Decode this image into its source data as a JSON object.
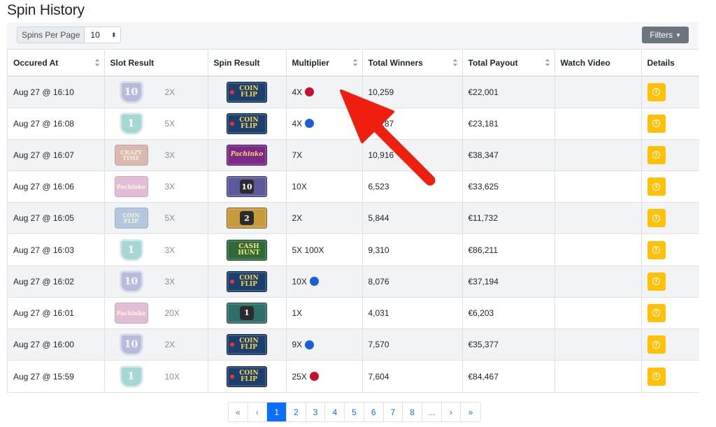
{
  "title": "Spin History",
  "toolbar": {
    "per_page_label": "Spins Per Page",
    "per_page_value": "10",
    "filters_label": "Filters"
  },
  "columns": [
    "Occured At",
    "Slot Result",
    "Spin Result",
    "Multiplier",
    "Total Winners",
    "Total Payout",
    "Watch Video",
    "Details"
  ],
  "rows": [
    {
      "occured_at": "Aug 27 @ 16:10",
      "slot_tile": "10",
      "slot_tile_color": "#8a8fc9",
      "slot_multiplier": "2X",
      "spin_result": "COIN FLIP",
      "multiplier": "4X",
      "multiplier_dot": "red",
      "total_winners": "10,259",
      "total_payout": "€22,001"
    },
    {
      "occured_at": "Aug 27 @ 16:08",
      "slot_tile": "1",
      "slot_tile_color": "#5fb7b0",
      "slot_multiplier": "5X",
      "spin_result": "COIN FLIP",
      "multiplier": "4X",
      "multiplier_dot": "blue",
      "total_winners": "10,187",
      "total_payout": "€23,181"
    },
    {
      "occured_at": "Aug 27 @ 16:07",
      "slot_tile": "CRAZY TIME",
      "slot_tile_color": "#c98a7a",
      "slot_multiplier": "3X",
      "spin_result": "Pachinko",
      "multiplier": "7X",
      "multiplier_dot": "",
      "total_winners": "10,916",
      "total_payout": "€38,347"
    },
    {
      "occured_at": "Aug 27 @ 16:06",
      "slot_tile": "Pachinko",
      "slot_tile_color": "#c98ab5",
      "slot_multiplier": "3X",
      "spin_result": "10",
      "multiplier": "10X",
      "multiplier_dot": "",
      "total_winners": "6,523",
      "total_payout": "€33,625"
    },
    {
      "occured_at": "Aug 27 @ 16:05",
      "slot_tile": "COIN FLIP",
      "slot_tile_color": "#7fa6c9",
      "slot_multiplier": "5X",
      "spin_result": "2",
      "multiplier": "2X",
      "multiplier_dot": "",
      "total_winners": "5,844",
      "total_payout": "€11,732"
    },
    {
      "occured_at": "Aug 27 @ 16:03",
      "slot_tile": "1",
      "slot_tile_color": "#5fb7b0",
      "slot_multiplier": "3X",
      "spin_result": "CASH HUNT",
      "multiplier": "5X 100X",
      "multiplier_dot": "",
      "total_winners": "9,310",
      "total_payout": "€86,211"
    },
    {
      "occured_at": "Aug 27 @ 16:02",
      "slot_tile": "10",
      "slot_tile_color": "#8a8fc9",
      "slot_multiplier": "3X",
      "spin_result": "COIN FLIP",
      "multiplier": "10X",
      "multiplier_dot": "blue",
      "total_winners": "8,076",
      "total_payout": "€37,194"
    },
    {
      "occured_at": "Aug 27 @ 16:01",
      "slot_tile": "Pachinko",
      "slot_tile_color": "#c98ab5",
      "slot_multiplier": "20X",
      "spin_result": "1",
      "multiplier": "1X",
      "multiplier_dot": "",
      "total_winners": "4,031",
      "total_payout": "€6,203"
    },
    {
      "occured_at": "Aug 27 @ 16:00",
      "slot_tile": "10",
      "slot_tile_color": "#8a8fc9",
      "slot_multiplier": "2X",
      "spin_result": "COIN FLIP",
      "multiplier": "9X",
      "multiplier_dot": "blue",
      "total_winners": "7,570",
      "total_payout": "€35,377"
    },
    {
      "occured_at": "Aug 27 @ 15:59",
      "slot_tile": "1",
      "slot_tile_color": "#5fb7b0",
      "slot_multiplier": "10X",
      "spin_result": "COIN FLIP",
      "multiplier": "25X",
      "multiplier_dot": "red",
      "total_winners": "7,604",
      "total_payout": "€84,467"
    }
  ],
  "pagination": {
    "first": "«",
    "prev": "‹",
    "pages": [
      "1",
      "2",
      "3",
      "4",
      "5",
      "6",
      "7",
      "8",
      "..."
    ],
    "active_page": "1",
    "next": "›",
    "last": "»"
  },
  "colors": {
    "detail_button": "#ffc107",
    "dot_red": "#c8102e",
    "dot_blue": "#1a5fd6",
    "active_page": "#0d6efd",
    "annotation_arrow": "#f01e0e"
  },
  "icons": {
    "sort": "sort-icon",
    "details": "info-icon",
    "annotation": "red-arrow-icon"
  }
}
